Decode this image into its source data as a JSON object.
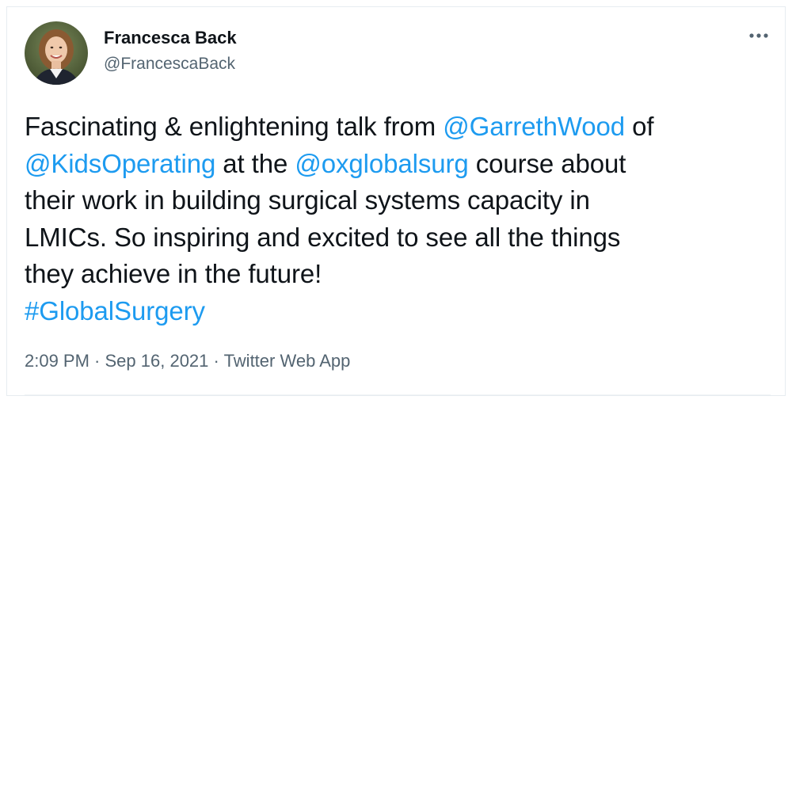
{
  "author": {
    "display_name": "Francesca Back",
    "handle": "@FrancescaBack",
    "avatar_icon": "profile-photo-avatar"
  },
  "tweet": {
    "lines": [
      [
        {
          "text": "Fascinating & enlightening talk from ",
          "kind": "text"
        },
        {
          "text": "@GarrethWood",
          "kind": "mention"
        },
        {
          "text": " of",
          "kind": "text"
        }
      ],
      [
        {
          "text": "@KidsOperating",
          "kind": "mention"
        },
        {
          "text": " at the ",
          "kind": "text"
        },
        {
          "text": "@oxglobalsurg",
          "kind": "mention"
        },
        {
          "text": " course about",
          "kind": "text"
        }
      ],
      [
        {
          "text": "their work in building surgical systems capacity in",
          "kind": "text"
        }
      ],
      [
        {
          "text": "LMICs. So inspiring and excited to see all the things",
          "kind": "text"
        }
      ],
      [
        {
          "text": "they achieve in the future!",
          "kind": "text"
        }
      ],
      [
        {
          "text": "#GlobalSurgery",
          "kind": "hashtag"
        }
      ]
    ]
  },
  "meta": {
    "time": "2:09 PM",
    "separator": " · ",
    "date": "Sep 16, 2021",
    "source": "Twitter Web App"
  },
  "icons": {
    "more": "more-options-icon"
  },
  "colors": {
    "link": "#1d9bf0",
    "text": "#0f1419",
    "secondary": "#536471"
  }
}
